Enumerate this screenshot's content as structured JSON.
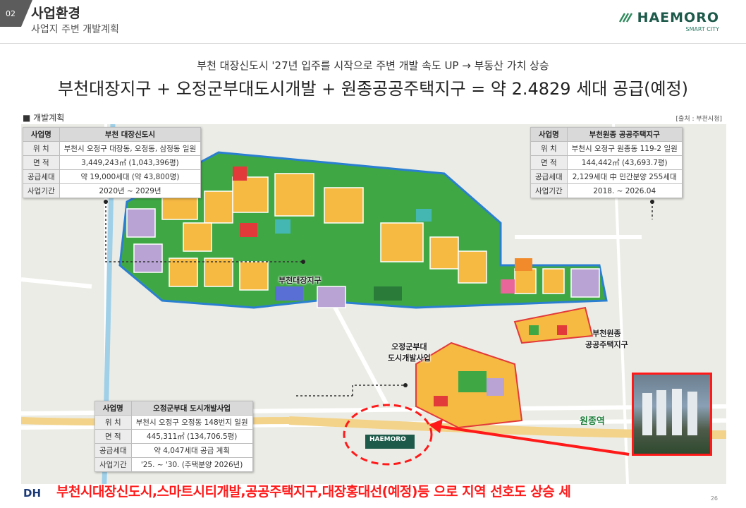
{
  "header": {
    "section_number": "02",
    "section_title": "사업환경",
    "section_subtitle": "사업지 주변 개발계획",
    "logo_text": "HAEMORO",
    "logo_sub": "SMART CITY"
  },
  "headline": {
    "sub": "부천 대장신도시 '27년 입주를 시작으로 주변 개발 속도 UP → 부동산 가치 상승",
    "main": "부천대장지구 + 오정군부대도시개발 + 원종공공주택지구 = 약 2.4829 세대 공급(예정)"
  },
  "plan_label": "■ 개발계획",
  "source_label": "[출처 : 부천시청]",
  "tables": {
    "daejang": {
      "head": [
        "사업명",
        "부천 대장신도시"
      ],
      "rows": [
        [
          "위  치",
          "부천시 오정구 대장동, 오정동, 삼정동 일원"
        ],
        [
          "면  적",
          "3,449,243㎡ (1,043,396평)"
        ],
        [
          "공급세대",
          "약 19,000세대 (약 43,800명)"
        ],
        [
          "사업기간",
          "2020년 ~ 2029년"
        ]
      ]
    },
    "wonjong": {
      "head": [
        "사업명",
        "부천원종 공공주택지구"
      ],
      "rows": [
        [
          "위  치",
          "부천시 오정구 원종동 119-2 일원"
        ],
        [
          "면  적",
          "144,442㎡ (43,693.7평)"
        ],
        [
          "공급세대",
          "2,129세대 中 민간분양 255세대"
        ],
        [
          "사업기간",
          "2018. ~ 2026.04"
        ]
      ]
    },
    "ojeong": {
      "head": [
        "사업명",
        "오정군부대 도시개발사업"
      ],
      "rows": [
        [
          "위  치",
          "부천시 오정구 오정동 148번지 일원"
        ],
        [
          "면  적",
          "445,311㎡ (134,706.5평)"
        ],
        [
          "공급세대",
          "약 4,047세대 공급 계획"
        ],
        [
          "사업기간",
          "'25. ~ '30. (주택분양 2026년)"
        ]
      ]
    }
  },
  "map_labels": {
    "daejang": "부천대장지구",
    "wonjong": "부천원종\n공공주택지구",
    "ojeong": "오정군부대\n도시개발사업",
    "station": "원종역",
    "logo": "HAEMORO"
  },
  "bottom_banner": "부천시대장신도시,스마트시티개발,공공주택지구,대장홍대선(예정)등 으로 지역 선호도 상승 세",
  "footer": {
    "logo": "DH",
    "page": "26"
  },
  "colors": {
    "accent_red": "#ff1a1a",
    "brand_green": "#1d5a4a",
    "zone_yellow": "#f6b942",
    "zone_green": "#3fa845",
    "zone_purple": "#b9a3d4"
  }
}
